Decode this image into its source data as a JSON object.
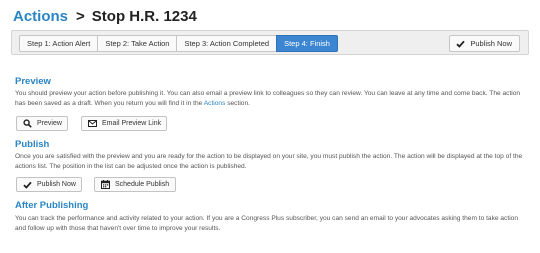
{
  "header": {
    "breadcrumb_link": "Actions",
    "separator": ">",
    "current_title": "Stop H.R. 1234"
  },
  "steps": [
    {
      "label": "Step 1: Action Alert"
    },
    {
      "label": "Step 2: Take Action"
    },
    {
      "label": "Step 3: Action Completed"
    },
    {
      "label": "Step 4: Finish",
      "active": true
    }
  ],
  "toolbar": {
    "publish_now_label": "Publish Now"
  },
  "preview": {
    "title": "Preview",
    "text_before_link": "You should preview your action before publishing it. You can also email a preview link to colleagues so they can review. You can leave at any time and come back. The action has been saved as a draft. When you return you will find it in the ",
    "link_text": "Actions",
    "text_after_link": " section.",
    "preview_button_label": "Preview",
    "email_link_button_label": "Email Preview Link"
  },
  "publish": {
    "title": "Publish",
    "text": "Once you are satisfied with the preview and you are ready for the action to be displayed on your site, you must publish the action. The action will be displayed at the top of the actions list. The position in the list can be adjusted once the action is published.",
    "publish_now_label": "Publish Now",
    "schedule_label": "Schedule Publish"
  },
  "after_publishing": {
    "title": "After Publishing",
    "text": "You can track the performance and activity related to your action. If you are a Congress Plus subscriber, you can send an email to your advocates asking them to take action and follow up with those that haven't over time to improve your results."
  },
  "colors": {
    "accent": "#2a85c4",
    "active_step": "#3c86d1",
    "step_bar_bg": "#efefef"
  },
  "icons": {
    "publish": "checkmark-icon",
    "preview": "magnifier-icon",
    "email": "envelope-icon",
    "schedule": "calendar-icon"
  }
}
